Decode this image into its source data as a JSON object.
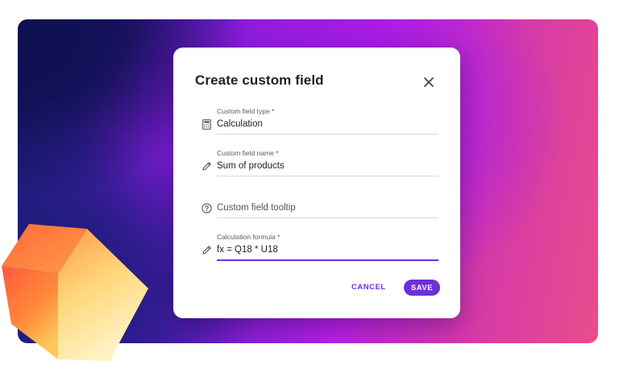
{
  "dialog": {
    "title": "Create custom field",
    "close_icon": "close-icon"
  },
  "fields": {
    "type": {
      "label": "Custom field type *",
      "value": "Calculation",
      "icon": "calculator-icon"
    },
    "name": {
      "label": "Custom field name *",
      "value": "Sum of products",
      "icon": "pencil-icon"
    },
    "tooltip": {
      "placeholder": "Custom field tooltip",
      "icon": "help-circle-icon"
    },
    "formula": {
      "label": "Calculation formula *",
      "value": "fx = Q18 * U18",
      "icon": "pencil-icon"
    }
  },
  "actions": {
    "cancel_label": "CANCEL",
    "save_label": "SAVE"
  },
  "colors": {
    "accent": "#6c2fd6",
    "dialog_bg": "#ffffff",
    "text": "#1f1f26"
  }
}
